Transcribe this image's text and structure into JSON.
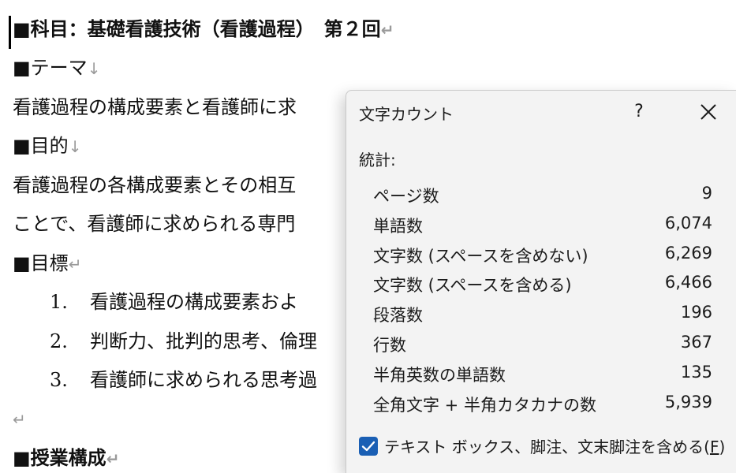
{
  "document": {
    "title_line": "■科目：基礎看護技術（看護過程）　第２回",
    "theme_heading": "■テーマ",
    "theme_text": "看護過程の構成要素と看護師に求",
    "purpose_heading": "■目的",
    "purpose_text_1": "看護過程の各構成要素とその相互",
    "purpose_text_2": "ことで、看護師に求められる専門",
    "goals_heading": "■目標",
    "goals": [
      {
        "num": "1.",
        "text": "看護過程の構成要素およ"
      },
      {
        "num": "2.",
        "text": "判断力、批判的思考、倫理"
      },
      {
        "num": "3.",
        "text": "看護師に求められる思考過"
      }
    ],
    "class_heading": "■授業構成",
    "para_mark": "↵",
    "line_break_mark": "↓"
  },
  "dialog": {
    "title": "文字カウント",
    "help_label": "?",
    "stats_label": "統計:",
    "stats": [
      {
        "label": "ページ数",
        "value": "9"
      },
      {
        "label": "単語数",
        "value": "6,074"
      },
      {
        "label": "文字数 (スペースを含めない)",
        "value": "6,269"
      },
      {
        "label": "文字数 (スペースを含める)",
        "value": "6,466"
      },
      {
        "label": "段落数",
        "value": "196"
      },
      {
        "label": "行数",
        "value": "367"
      },
      {
        "label": "半角英数の単語数",
        "value": "135"
      },
      {
        "label": "全角文字 + 半角カタカナの数",
        "value": "5,939"
      }
    ],
    "include_label": "テキスト ボックス、脚注、文末脚注を含める(",
    "include_accel": "F",
    "include_close": ")",
    "include_checked": true,
    "checkbox_color": "#1a5fb4"
  }
}
